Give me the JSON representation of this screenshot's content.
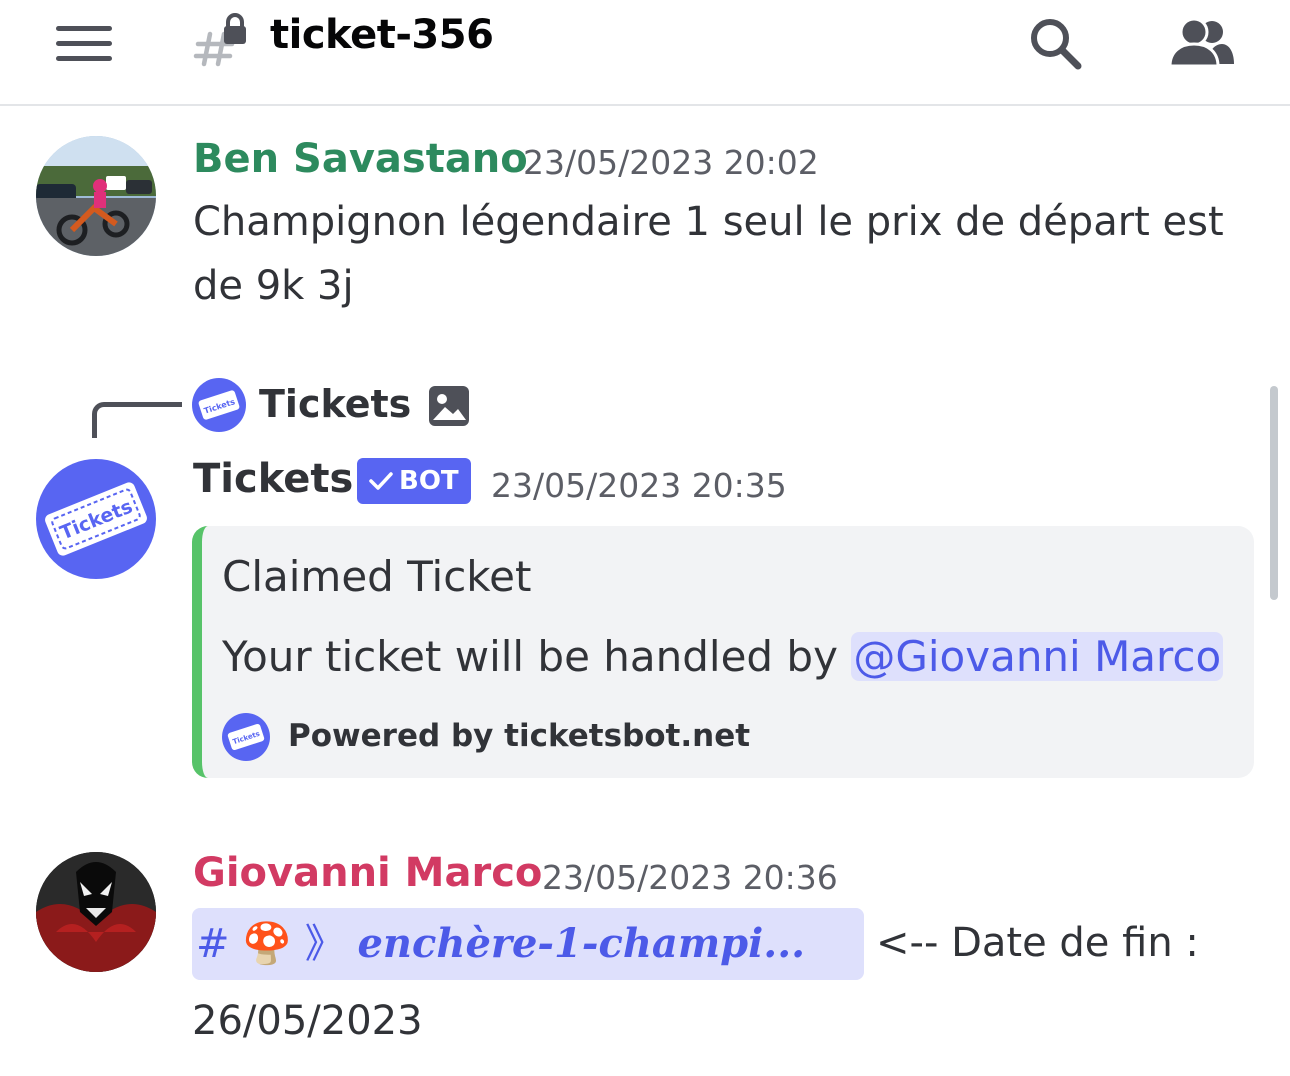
{
  "header": {
    "channel_name": "ticket-356",
    "menu_icon": "hamburger-icon",
    "channel_icon": "locked-hashtag-icon",
    "search_icon": "search-icon",
    "members_icon": "members-icon"
  },
  "messages": [
    {
      "author": "Ben Savastano",
      "author_color": "#2d8a5e",
      "timestamp": "23/05/2023 20:02",
      "text_line1": "Champignon légendaire 1 seul le prix de départ est",
      "text_line2": "de 9k 3j",
      "avatar": "motorbike-photo-avatar"
    },
    {
      "reply": {
        "author": "Tickets",
        "icon": "image-icon"
      },
      "author": "Tickets",
      "author_color": "#313338",
      "badge": "BOT",
      "timestamp": "23/05/2023 20:35",
      "avatar": "tickets-bot-avatar",
      "embed": {
        "title": "Claimed Ticket",
        "description_prefix": "Your ticket will be handled by ",
        "mention": "@Giovanni Marco",
        "footer": "Powered by ticketsbot.net",
        "accent_color": "#57c369"
      }
    },
    {
      "author": "Giovanni Marco",
      "author_color": "#d23a63",
      "timestamp": "23/05/2023 20:36",
      "avatar": "venom-avatar",
      "channel_link": {
        "hash": "#",
        "emoji": "🍄",
        "chevron": "》",
        "name": "enchère-1-champi..."
      },
      "text_after": "<-- Date de fin :",
      "text_line2": "26/05/2023"
    }
  ]
}
